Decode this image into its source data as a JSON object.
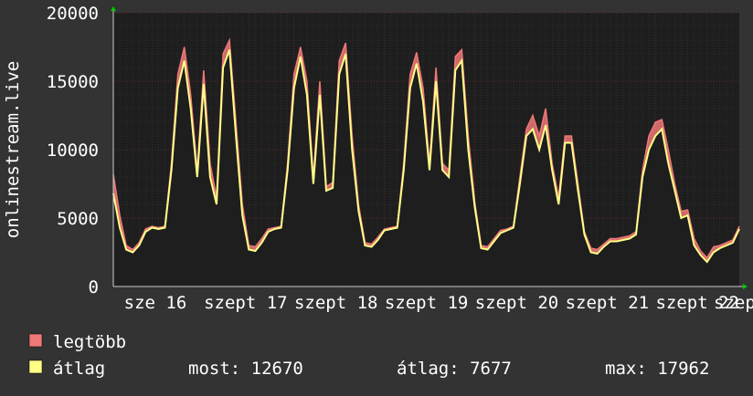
{
  "colors": {
    "background": "#333333",
    "plot_area": "#1e1e1e",
    "max_series": "#ee7777",
    "avg_series": "#ffff88",
    "grid": "#5a2a2a",
    "axis_arrow": "#00cc00",
    "text": "#ffffff"
  },
  "chart_data": {
    "type": "area",
    "ylabel": "onlinestream.live",
    "ylim": [
      0,
      20000
    ],
    "yticks": [
      0,
      5000,
      10000,
      15000,
      20000
    ],
    "ytick_labels": [
      "0",
      "5000",
      "10000",
      "15000",
      "20000"
    ],
    "xlim": [
      0,
      97
    ],
    "xtick_positions": [
      0,
      14,
      28,
      42,
      56,
      70,
      84
    ],
    "xtick_labels": [
      "sze 16",
      "szept 17",
      "szept 18",
      "szept 19",
      "szept 20",
      "szept 21",
      "szept 22"
    ],
    "x_suffix_label": "szep",
    "series": [
      {
        "name": "legtöbb",
        "color": "#ee7777",
        "values": [
          8200,
          5200,
          3000,
          2700,
          3200,
          4200,
          4400,
          4300,
          4400,
          9000,
          15500,
          17500,
          14000,
          8500,
          15800,
          9000,
          6500,
          17000,
          18000,
          12000,
          6000,
          3000,
          2900,
          3500,
          4200,
          4300,
          4400,
          9000,
          15500,
          17500,
          15000,
          8000,
          15000,
          7300,
          7600,
          16500,
          17800,
          11000,
          6000,
          3200,
          3100,
          3600,
          4200,
          4300,
          4400,
          9000,
          15500,
          17100,
          14500,
          9000,
          16000,
          9000,
          8500,
          16800,
          17300,
          11000,
          6200,
          3000,
          2900,
          3500,
          4100,
          4200,
          4400,
          8000,
          11500,
          12500,
          11000,
          13000,
          9000,
          6500,
          11000,
          11000,
          7500,
          4000,
          2800,
          2700,
          3100,
          3500,
          3500,
          3600,
          3700,
          4000,
          8500,
          11000,
          12000,
          12200,
          10000,
          7500,
          5500,
          5600,
          3500,
          2600,
          2100,
          2900,
          3000,
          3200,
          3400,
          4400
        ]
      },
      {
        "name": "átlag",
        "color": "#ffff88",
        "values": [
          6800,
          4300,
          2700,
          2500,
          3000,
          4000,
          4300,
          4200,
          4300,
          8500,
          14500,
          16500,
          13000,
          8000,
          14800,
          8000,
          6000,
          16000,
          17300,
          11000,
          5200,
          2700,
          2600,
          3200,
          4000,
          4200,
          4300,
          8500,
          14500,
          16800,
          14000,
          7500,
          14000,
          7000,
          7200,
          15500,
          17000,
          10000,
          5500,
          3000,
          2900,
          3400,
          4100,
          4200,
          4300,
          8500,
          14500,
          16300,
          13500,
          8500,
          15000,
          8500,
          8000,
          15800,
          16500,
          10000,
          5800,
          2800,
          2700,
          3300,
          3900,
          4100,
          4300,
          7500,
          11000,
          11500,
          10000,
          11800,
          8500,
          6000,
          10500,
          10500,
          7000,
          3800,
          2500,
          2400,
          2900,
          3300,
          3300,
          3400,
          3500,
          3800,
          8000,
          10000,
          11000,
          11500,
          9000,
          7000,
          5000,
          5200,
          3000,
          2300,
          1800,
          2500,
          2800,
          3000,
          3200,
          4200
        ]
      }
    ]
  },
  "legend": {
    "items": [
      {
        "label": "legtöbb",
        "color": "#ee7777"
      },
      {
        "label": "átlag",
        "color": "#ffff88"
      }
    ],
    "stats": {
      "current": "most: 12670",
      "average": "átlag: 7677",
      "max": "max: 17962"
    }
  }
}
